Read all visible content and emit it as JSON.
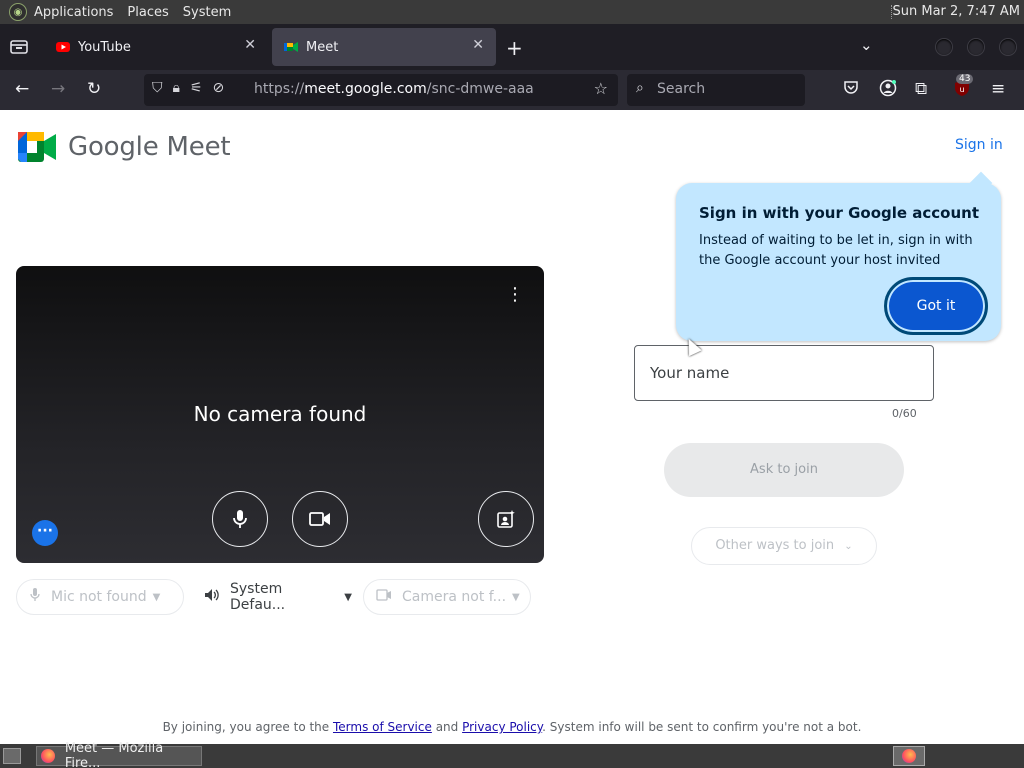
{
  "top_panel": {
    "menus": [
      "Applications",
      "Places",
      "System"
    ],
    "clock": "Sun Mar  2,  7:47 AM"
  },
  "browser": {
    "tabs": [
      {
        "title": "YouTube",
        "active": false
      },
      {
        "title": "Meet",
        "active": true
      }
    ],
    "url": {
      "scheme": "https://",
      "host": "meet.google.com",
      "path": "/snc-dmwe-aaa"
    },
    "search_placeholder": "Search",
    "extension_badge": "43"
  },
  "meet": {
    "brand": "Google Meet",
    "sign_in_label": "Sign in",
    "preview_message": "No camera found",
    "devices": {
      "mic": "Mic not found",
      "speaker": "System Defau...",
      "camera": "Camera not f..."
    },
    "tooltip": {
      "title": "Sign in with your Google account",
      "body": "Instead of waiting to be let in, sign in with the Google account your host invited",
      "button": "Got it"
    },
    "name_placeholder": "Your name",
    "char_count": "0/60",
    "ask_join_label": "Ask to join",
    "other_ways_label": "Other ways to join",
    "footer": {
      "prefix": "By joining, you agree to the ",
      "terms": "Terms of Service",
      "and": " and ",
      "privacy": "Privacy Policy",
      "suffix": ". System info will be sent to confirm you're not a bot."
    }
  },
  "taskbar": {
    "window_title": "Meet — Mozilla Fire..."
  },
  "colors": {
    "meet_blue": "#1a73e8",
    "tooltip_bg": "#c2e7ff",
    "got_it_bg": "#0b57d0"
  }
}
